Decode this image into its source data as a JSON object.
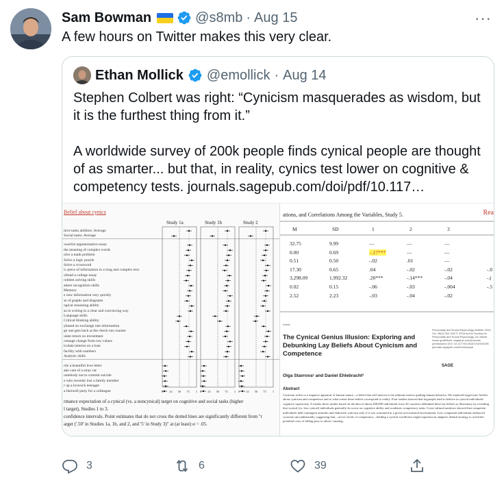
{
  "tweet": {
    "author_name": "Sam Bowman",
    "handle": "@s8mb",
    "separator": "·",
    "date": "Aug 15",
    "text": "A few hours on Twitter makes this very clear.",
    "more_label": "···"
  },
  "quote": {
    "author_name": "Ethan Mollick",
    "handle": "@emollick",
    "separator": "·",
    "date": "Aug 14",
    "paragraph1": "Stephen Colbert was right: “Cynicism masquerades as wisdom, but it is the furthest thing from it.”",
    "paragraph2": "A worldwide survey of 200k people finds cynical people are thought of as smarter... but that, in reality, cynics test lower on cognitive & competency tests. journals.sagepub.com/doi/pdf/10.117…"
  },
  "media_left": {
    "title": "Belief about cynics",
    "columns": [
      "Study 1a",
      "Study 1b",
      "Study 2"
    ],
    "rows": [
      "itive tasks abilities: Average",
      "Social tasks: Average",
      "owerful argumentative essay",
      "the meaning of complex words",
      "olve a math problem",
      "Solve a logic puzzle",
      "Solve a crossword",
      "ic piece of information in a long and complex text",
      "ofread a college essay",
      "roblem solving skills",
      "attern recognition skills",
      "Memory",
      "e new information very quickly",
      "se of graphs and diagrams",
      "ogical reasoning ability",
      "as in writing in a clear and convincing way",
      "Language skills",
      "Critical thinking ability",
      "ybased on exchange rate information",
      "ge one gets back at the check-out counter",
      "ulate return on investment",
      "centage change from raw values",
      "lculate interest on a loan",
      "facility with numbers",
      "Analytic skills",
      "rite a beautiful love letter",
      "ake care of a stray cat",
      "omebody not to commit suicide",
      "e who recently lost a family member",
      "r up a lovesick teenager",
      "a farewell party for a colleague"
    ],
    "axis_ticks": [
      "0",
      "25",
      "50",
      "75",
      "1"
    ],
    "caption1": "rmance expectation of a cynical (vs. a noncynical) target on cognitive and social tasks (higher",
    "caption2": "l target), Studies 1 to 3.",
    "caption3": "confidence intervals. Point estimates that do not cross the dotted lines are significantly different from \"r",
    "caption4": "arget ('.50' in Studies 1a, 1b, and 2, and '5' in Study 3)\" at (at least) α = .05."
  },
  "media_right": {
    "title": "ations, and Correlations Among the Variables, Study 5.",
    "corner_text": "Rea",
    "headers": [
      "M",
      "SD",
      "1",
      "2",
      "3"
    ],
    "rows": [
      [
        "32.75",
        "9.99",
        "—",
        "—",
        "—"
      ],
      [
        "0.00",
        "0.69",
        "-.17***",
        "—",
        "—"
      ],
      [
        "0.51",
        "0.50",
        "-.02",
        ".01",
        "—"
      ],
      [
        "17.30",
        "0.65",
        ".04",
        "-.02",
        "-.02"
      ],
      [
        "3,298.09",
        "1,992.32",
        ".20***",
        "-.14***",
        "-.04"
      ],
      [
        "0.02",
        "0.15",
        "-.06",
        "-.03",
        "-.004"
      ],
      [
        "2.52",
        "2.23",
        "-.03",
        "-.04",
        "-.02"
      ]
    ],
    "extra_col": [
      "-.0",
      "-.(",
      "-.5"
    ],
    "paper_label": "Article",
    "paper_title": "The Cynical Genius Illusion: Exploring and Debunking Lay Beliefs About Cynicism and Competence",
    "journal_info": "Personality and Social Psychology Bulletin 2019, Vol. 45(2) 254–269 © 2018 by the Society for Personality and Social Psychology, Inc Article reuse guidelines: sagepub.com/journals-permissions DOI: 10.1177/0146167218783195 journals.sagepub.com/home/pspb",
    "sage_label": "SAGE",
    "authors": "Olga Stavrova¹ and Daniel Ehlebracht²",
    "abstract_heading": "Abstract",
    "abstract": "Cynicism refers to a negative appraisal of human nature—a belief that self-interest is the ultimate motive guiding human behavior. We explored laypersons' beliefs about cynicism and competence and to what extent these beliefs correspond to reality. Four studies showed that laypeople tend to believe in cynical individuals' cognitive superiority. A further three studies based on the data of about 200,000 individuals from 30 countries debunked these lay beliefs as illusionary by revealing that cynical (vs. less cynical) individuals generally do worse on cognitive ability and academic competency tasks. Cross-cultural analyses showed that competent individuals held contingent attitudes and endorsed cynicism only if it was warranted in a given sociocultural environment. Less competent individuals embraced cynicism unconditionally, suggesting that—at low levels of competence—holding a cynical worldview might represent an adaptive default strategy to avoid the potential costs of falling prey to others' cunning."
  },
  "actions": {
    "reply_count": "3",
    "retweet_count": "6",
    "like_count": "39"
  },
  "colors": {
    "text": "#0f1419",
    "muted": "#536471",
    "verified": "#1d9bf0",
    "border": "#cfd9de",
    "highlight": "#fff35c"
  },
  "icons": [
    "verified-badge-icon",
    "ukraine-flag-icon",
    "more-icon",
    "reply-icon",
    "retweet-icon",
    "like-icon",
    "share-icon"
  ]
}
